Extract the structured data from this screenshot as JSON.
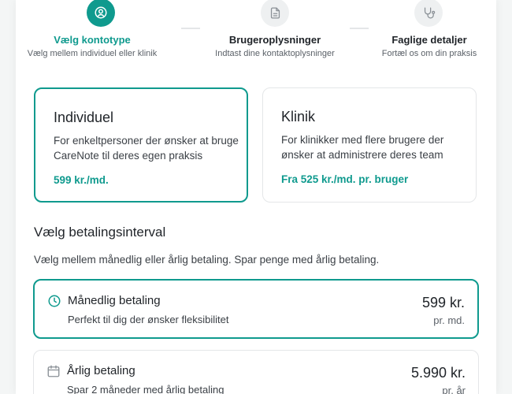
{
  "colors": {
    "accent": "#0f9a8e",
    "border": "#e4e6e8",
    "inactive_circle": "#eef0f1"
  },
  "steps": [
    {
      "title": "Vælg kontotype",
      "subtitle": "Vælg mellem individuel eller klinik",
      "icon": "user-circle-icon",
      "active": true
    },
    {
      "title": "Brugeroplysninger",
      "subtitle": "Indtast dine kontaktoplysninger",
      "icon": "document-icon",
      "active": false
    },
    {
      "title": "Faglige detaljer",
      "subtitle": "Fortæl os om din praksis",
      "icon": "stethoscope-icon",
      "active": false
    }
  ],
  "account_types": [
    {
      "title": "Individuel",
      "description": "For enkeltpersoner der ønsker at bruge CareNote til deres egen praksis",
      "price": "599 kr./md.",
      "selected": true
    },
    {
      "title": "Klinik",
      "description": "For klinikker med flere brugere der ønsker at administrere deres team",
      "price": "Fra 525 kr./md. pr. bruger",
      "selected": false
    }
  ],
  "billing": {
    "title": "Vælg betalingsinterval",
    "subtitle": "Vælg mellem månedlig eller årlig betaling. Spar penge med årlig betaling.",
    "options": [
      {
        "title": "Månedlig betaling",
        "description": "Perfekt til dig der ønsker fleksibilitet",
        "price": "599 kr.",
        "unit": "pr. md.",
        "icon": "clock-icon",
        "selected": true
      },
      {
        "title": "Årlig betaling",
        "description": "Spar 2 måneder med årlig betaling",
        "price": "5.990 kr.",
        "unit": "pr. år",
        "icon": "calendar-icon",
        "selected": false
      }
    ]
  }
}
